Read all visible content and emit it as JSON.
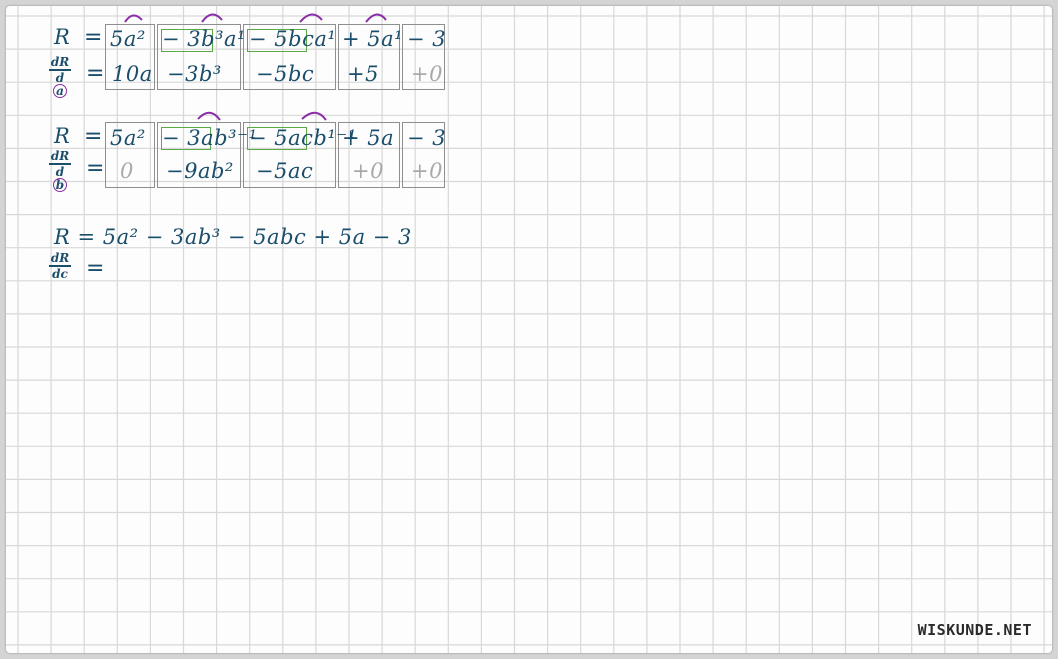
{
  "block_a": {
    "lhs": "R",
    "d_num": "dR",
    "d_den": "a",
    "terms": [
      "5a²",
      "− 3b³a¹",
      "− 5bca¹",
      "+ 5a¹",
      "− 3"
    ],
    "derivs": [
      "10a",
      "−3b³",
      "−5bc",
      "+5",
      "+0"
    ]
  },
  "block_b": {
    "lhs": "R",
    "d_num": "dR",
    "d_den": "b",
    "terms": [
      "5a²",
      "− 3ab³⁻¹",
      "− 5acb¹⁻¹",
      "+ 5a",
      "− 3"
    ],
    "derivs": [
      "0",
      "−9ab²",
      "−5ac",
      "+0",
      "+0"
    ]
  },
  "block_c": {
    "expr": "R = 5a² − 3ab³ − 5abc + 5a − 3",
    "d_num": "dR",
    "d_den": "dc"
  },
  "equals": "=",
  "logo": "WISKUNDE.NET",
  "colors": {
    "ink": "#1b4e6b",
    "box": "#8f8f8f",
    "green": "#5aa846",
    "arrow": "#8a2da8",
    "grey": "#a9a9a9"
  }
}
